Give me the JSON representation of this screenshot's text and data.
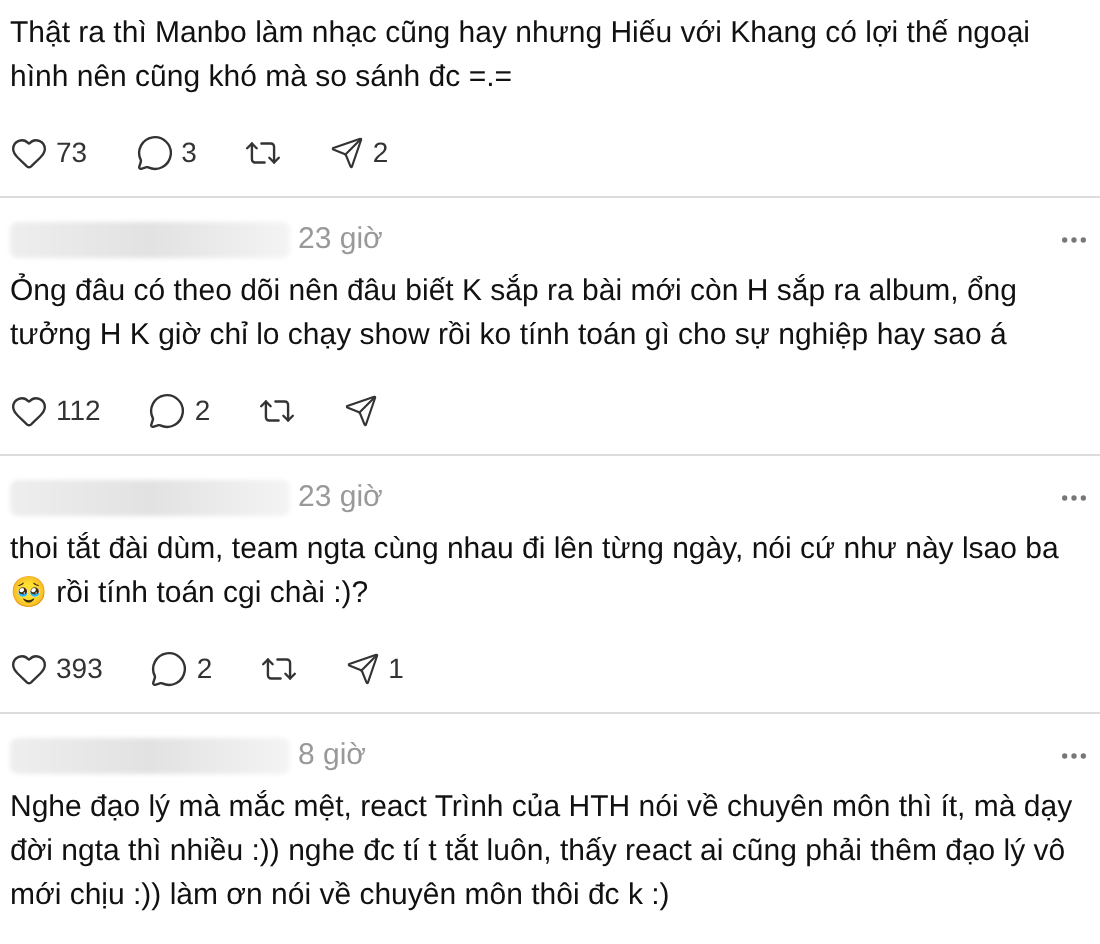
{
  "posts": [
    {
      "text": "Thật ra thì Manbo làm nhạc cũng hay nhưng Hiếu với Khang có lợi thế ngoại hình nên cũng khó mà so sánh đc =.=",
      "likes": "73",
      "replies": "3",
      "shares": "2"
    },
    {
      "time": "23 giờ",
      "text": "Ỏng đâu có theo dõi nên đâu biết K sắp ra bài mới còn H sắp ra album, ổng tưởng H K giờ chỉ lo chạy show rồi ko tính toán gì cho sự nghiệp hay sao á",
      "likes": "112",
      "replies": "2"
    },
    {
      "time": "23 giờ",
      "text": "thoi tắt đài dùm, team ngta cùng nhau đi lên từng ngày, nói cứ như này lsao ba 🥹 rồi tính toán cgi chài :)?",
      "likes": "393",
      "replies": "2",
      "shares": "1"
    },
    {
      "time": "8 giờ",
      "text": "Nghe đạo lý mà mắc mệt, react Trình của HTH nói về chuyên môn thì ít, mà dạy đời ngta thì nhiều :)) nghe đc tí t tắt luôn, thấy react ai cũng phải thêm đạo lý vô mới chịu :)) làm ơn nói về chuyên môn thôi đc k :)"
    }
  ]
}
